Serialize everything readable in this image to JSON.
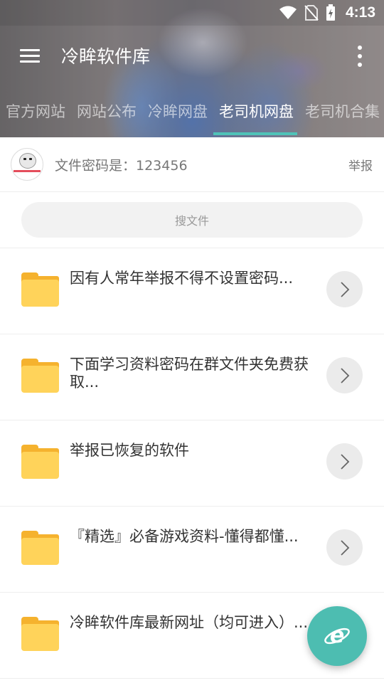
{
  "status_bar": {
    "time": "4:13",
    "icons": [
      "wifi-icon",
      "no-sim-icon",
      "battery-charging-icon"
    ]
  },
  "app": {
    "title": "冷眸软件库"
  },
  "tabs": [
    {
      "label": "官方网站",
      "active": false
    },
    {
      "label": "网站公布",
      "active": false
    },
    {
      "label": "冷眸网盘",
      "active": false
    },
    {
      "label": "老司机网盘",
      "active": true
    },
    {
      "label": "老司机合集",
      "active": false
    }
  ],
  "notice": {
    "text": "文件密码是：123456",
    "report_label": "举报"
  },
  "search": {
    "placeholder": "搜文件"
  },
  "files": [
    {
      "name": "因有人常年举报不得不设置密码..."
    },
    {
      "name": "下面学习资料密码在群文件夹免费获取..."
    },
    {
      "name": "举报已恢复的软件"
    },
    {
      "name": "『精选』必备游戏资料-懂得都懂..."
    },
    {
      "name": "冷眸软件库最新网址（均可进入）..."
    }
  ],
  "colors": {
    "accent": "#4fc3b8",
    "folder": "#ffd35a",
    "fab": "#4dbdb1"
  },
  "fab_icon": "browser-e-icon"
}
